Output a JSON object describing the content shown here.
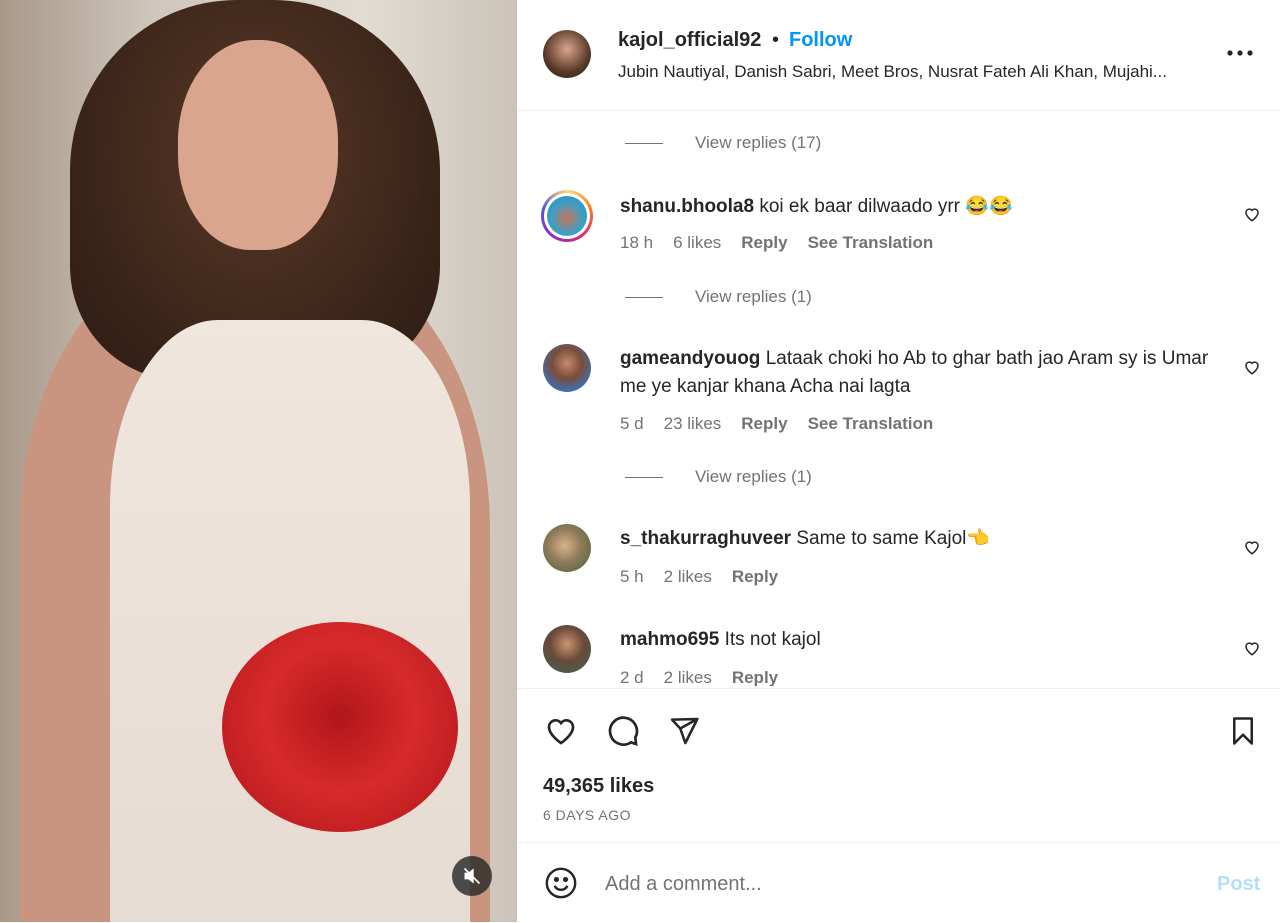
{
  "header": {
    "username": "kajol_official92",
    "dot": "•",
    "follow_label": "Follow",
    "audio": "Jubin Nautiyal, Danish Sabri, Meet Bros, Nusrat Fateh Ali Khan, Mujahi..."
  },
  "comments": [
    {
      "type": "view_replies",
      "label": "View replies (17)"
    },
    {
      "username": "shanu.bhoola8",
      "text": "koi ek baar dilwaado yrr 😂😂",
      "time": "18 h",
      "likes": "6 likes",
      "reply": "Reply",
      "translate": "See Translation",
      "view_replies": "View replies (1)"
    },
    {
      "username": "gameandyouog",
      "text": "Lataak choki ho Ab to ghar bath jao Aram sy is Umar me ye kanjar khana Acha nai lagta",
      "time": "5 d",
      "likes": "23 likes",
      "reply": "Reply",
      "translate": "See Translation",
      "view_replies": "View replies (1)"
    },
    {
      "username": "s_thakurraghuveer",
      "text": "Same to same Kajol👈",
      "time": "5 h",
      "likes": "2 likes",
      "reply": "Reply"
    },
    {
      "username": "mahmo695",
      "text": "Its not kajol",
      "time": "2 d",
      "likes": "2 likes",
      "reply": "Reply"
    }
  ],
  "footer": {
    "likes": "49,365 likes",
    "ago": "6 DAYS AGO",
    "comment_placeholder": "Add a comment...",
    "post_label": "Post"
  },
  "icons": {
    "more": "more-icon",
    "like": "heart-icon",
    "comment": "comment-icon",
    "share": "send-icon",
    "save": "bookmark-icon",
    "emoji": "emoji-icon",
    "mute": "muted-audio-icon"
  },
  "colors": {
    "link_blue": "#0095f6",
    "muted_text": "#737373",
    "post_disabled": "#b2dffc"
  }
}
